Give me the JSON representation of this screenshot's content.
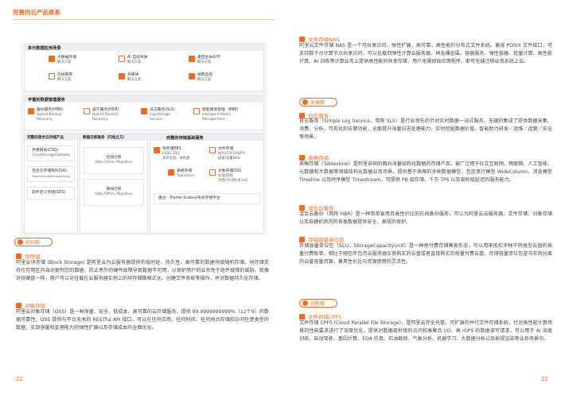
{
  "header": {
    "title": "完善的云产品体系"
  },
  "diagram": {
    "scenarios": {
      "title": "多元数据应用场景",
      "items": [
        {
          "l1": "大数据存储",
          "l2": "解决方案"
        },
        {
          "l1": "AI 自动驾驶",
          "l2": "解决方案"
        },
        {
          "l1": "基因生命科学",
          "l2": "解决方案"
        },
        {
          "l1": "在线教育",
          "l2": "解决方案"
        },
        {
          "l1": "多媒体",
          "l2": "解决方案"
        },
        {
          "l1": "视频监控",
          "l2": "解决方案"
        }
      ]
    },
    "management": {
      "title": "丰富的数据管理服务",
      "items": [
        {
          "l1": "备份服务(HBR)",
          "l2": "Hybrid Backup",
          "l3": "Recovery"
        },
        {
          "l1": "容灾服务(HDR)",
          "l2": "Hybrid Disaster",
          "l3": "Recovery"
        },
        {
          "l1": "日志服务(SLS)",
          "l2": "Log Storage",
          "l3": "Service"
        },
        {
          "l1": "智能媒体管理（IMM)",
          "l2": "Intelligent Media",
          "l3": "Management"
        }
      ]
    },
    "hybrid": {
      "title": "完整的混合云存储产品",
      "items": [
        {
          "l1": "存储网关(CSG)",
          "l2": "CloudStorageGateway"
        },
        {
          "l1": "混合云存储阵列(SA)",
          "l2": "HybridCloudStorageArray"
        },
        {
          "l1": "软件定义存储(SDS)",
          "l2": ""
        }
      ]
    },
    "migration": {
      "title": "数据迁移服务（闪电立方）",
      "items": [
        {
          "l1": "在线迁移",
          "l2": "Data Online Migration"
        },
        {
          "l1": "离线迁移",
          "l2": "Data Offline Migration"
        }
      ]
    },
    "storage": {
      "title": "完整的存储基础服务",
      "items": [
        {
          "l1": "块存储EBS",
          "l2": "ESSD,SSD",
          "l3": "高效云盘、本地盘"
        },
        {
          "l1": "文件存储",
          "l2": "NAS/CPFS/HDFS",
          "l3": "极速/容量NAS"
        },
        {
          "l1": "表格存储",
          "l2": "Tablestore",
          "l3": ""
        },
        {
          "l1": "对象存储OSS",
          "l2": "标准/低频",
          "l3": "归档/冷归档/多3AZ"
        }
      ],
      "pangu": "盘古：Planet-Scale分布式存储平台"
    }
  },
  "left": {
    "phase_pill": "初创期",
    "s1_title": "块存储",
    "s1_body": "阿里云块存储 (Block Storage) 是阿里云为云服务器提供的低时延、持久性、高可靠的数据块级随机存储。块存储支持在可用区内自动复制您的数据，防止意外的硬件故障导致数据不可用，以保护用户的业务免于组件故障的威胁。就像对待硬盘一样，用户可以对挂载在云服务器实例上的块存储做格式化、创建文件系统等操作，并对数据持久化存储。",
    "s2_title": "对象存储",
    "s2_body": "阿里云对象存储（OSS）是一种海量、安全、低成本、高可靠的云存储服务，提供 99.9999999999%（12个9）的数据可靠性。OSS 提供与平台无关的 RESTful API 接口，可以在任何应用、任何时间、任何地点存储和访问任意类型的数据，实现容量和处理能力的弹性扩展以及存储成本的全面优化。",
    "page_number": "21"
  },
  "right": {
    "s1_title": "文件存储NAS",
    "s1_body": "阿里云文件存储 NAS 是一个可共享访问，弹性扩展，高可靠，高性能的分布式文件系统。兼容 POSIX 文件接口，可支持数千台计算节点共享访问，可以挂载到弹性计算云服务器、神龙裸金属、容器服务、弹性容器、批量计算、高性能计算、AI 训练等计算业务上提供高性能的共享存储，用户无需修改应用程序，即可无缝迁移业务系统上云。",
    "phase2_pill": "发展期",
    "s2_title": "日志服务",
    "s2_body": "日志服务（Simple Log Service，简称 SLS）是行业领先的针对实时数据一站式服务，无缝的集成了提供数据采集、消费、分析、可视化和告警功能，全面提升海量日志处理能力，实时挖掘数据价值，智能助力研发／运维／运营／安全等场景。",
    "s3_title": "表格存储",
    "s3_body": "表格存储（Tablestore）是阿里自研的面向海量结构化数据的存储产品，被广泛用于社交互联网、物联网、人工智能、元数据和大数据等领域结构化数据业务场景。提供基于表格的多种数据模型，包括宽行模型 WideColumn、消息模型 Timeline 以及时序模型 Timestream，可提供 PB 级存储、千万 TPS 以及毫秒级延迟的服务能力。",
    "s4_title": "混合云备份",
    "s4_body": "混合云备份（简称 HBR）是一种简单易用且高性价比的在线备份服务，可以为阿里云云服务器、文件存储、对象存储以及自建机房内的各类数据提供安全、高效的保护。",
    "s5_title": "存储容量单位包",
    "s5_body": "存储容量单位包（SCU，StorageCapacityUnit）是一种预付费存储售卖形态，可以用来抵扣多种不同类型云盘的按量付费账单，相比于随包年包月云服务器实例购买的云盘或者直接购买的按量付费云盘，存储容量单位包是与实例分离的云盘容量资源，兼具性价比与资源使用的灵活性。",
    "phase3_pill": "创新期",
    "s6_title": "文件存储CPFS",
    "s6_body": "文件存储 CPFS (Cloud Parallel File Storage)，是阿里云完全托管、可扩展的并行文件存储系统，针对高性能计算场景的性能要求进行了深度优化，提供对数据毫秒级的访问和高聚合 I/O、高 IOPS 的数据读写请求，可以用于 AI 深度训练、自动驾驶、基因计算、EDA 仿真、石油勘探、气象分析、机器学习、大数据分析以及影视渲染等业务场景中。",
    "page_number": "22"
  },
  "colors": {
    "accent": "#f26b21"
  }
}
